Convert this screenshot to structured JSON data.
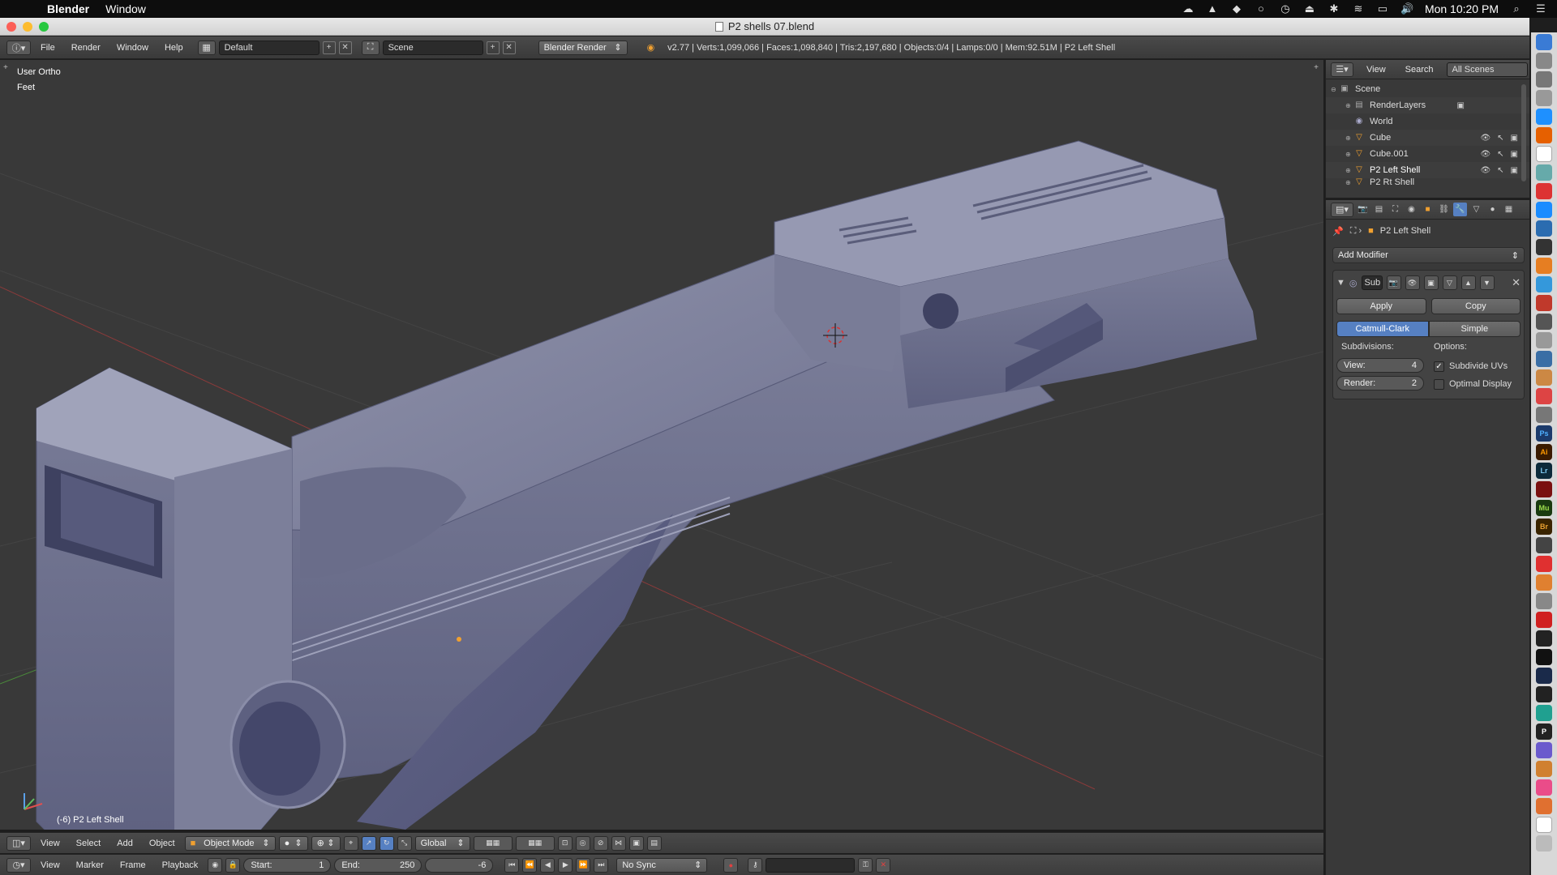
{
  "menubar": {
    "app": "Blender",
    "items": [
      "Window"
    ],
    "clock": "Mon 10:20 PM"
  },
  "window": {
    "title": "P2 shells 07.blend"
  },
  "info": {
    "menus": [
      "File",
      "Render",
      "Window",
      "Help"
    ],
    "screen_layout": "Default",
    "scene": "Scene",
    "engine": "Blender Render",
    "stats": "v2.77 | Verts:1,099,066 | Faces:1,098,840 | Tris:2,197,680 | Objects:0/4 | Lamps:0/0 | Mem:92.51M | P2 Left Shell"
  },
  "viewport": {
    "view_name": "User Ortho",
    "units": "Feet",
    "object_label": "(-6) P2 Left Shell"
  },
  "viewport_header": {
    "menus": [
      "View",
      "Select",
      "Add",
      "Object"
    ],
    "mode": "Object Mode",
    "orientation": "Global"
  },
  "timeline": {
    "menus": [
      "View",
      "Marker",
      "Frame",
      "Playback"
    ],
    "start_label": "Start:",
    "start_value": "1",
    "end_label": "End:",
    "end_value": "250",
    "current_frame": "-6",
    "sync": "No Sync"
  },
  "outliner": {
    "tabs": [
      "View",
      "Search"
    ],
    "filter": "All Scenes",
    "rows": [
      {
        "label": "Scene",
        "icon": "scene-icon",
        "indent": 0
      },
      {
        "label": "RenderLayers",
        "icon": "renderlayers-icon",
        "indent": 1
      },
      {
        "label": "World",
        "icon": "world-icon",
        "indent": 1
      },
      {
        "label": "Cube",
        "icon": "mesh-icon",
        "indent": 1
      },
      {
        "label": "Cube.001",
        "icon": "mesh-icon",
        "indent": 1
      },
      {
        "label": "P2 Left Shell",
        "icon": "mesh-icon",
        "indent": 1
      },
      {
        "label": "P2 Rt Shell",
        "icon": "mesh-icon",
        "indent": 1
      }
    ]
  },
  "properties": {
    "object_name": "P2 Left Shell",
    "add_modifier": "Add Modifier",
    "modifier_name": "Sub",
    "apply": "Apply",
    "copy": "Copy",
    "catmull": "Catmull-Clark",
    "simple": "Simple",
    "subdivisions_label": "Subdivisions:",
    "options_label": "Options:",
    "view_label": "View:",
    "view_value": "4",
    "render_label": "Render:",
    "render_value": "2",
    "subdivide_uvs": "Subdivide UVs",
    "optimal_display": "Optimal Display",
    "subdivide_uvs_checked": true,
    "optimal_display_checked": false
  },
  "dock": {
    "labels": [
      "Ps",
      "Ai",
      "Lr",
      "Mu",
      "Br",
      "P"
    ]
  },
  "colors": {
    "accent": "#5680c2",
    "viewport_bg": "#393939",
    "model": "#7a7c96"
  }
}
